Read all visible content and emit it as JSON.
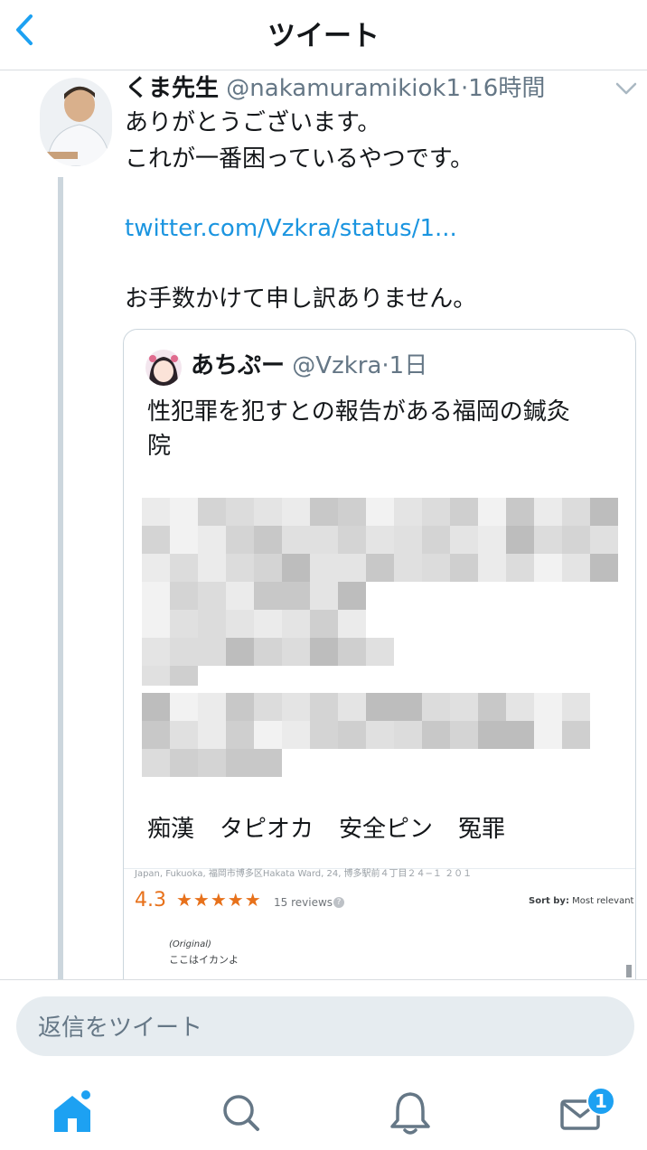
{
  "header": {
    "title": "ツイート"
  },
  "tweet": {
    "display_name": "くま先生",
    "handle": "@nakamuramikiok1",
    "separator": "·",
    "time": "16時間",
    "lines": [
      "ありがとうございます。",
      "これが一番困っているやつです。",
      "twitter.com/Vzkra/status/1...",
      "お手数かけて申し訳ありません。"
    ]
  },
  "quote": {
    "display_name": "あちぷー",
    "handle": "@Vzkra",
    "separator": "·",
    "time": "1日",
    "text_lines": [
      "性犯罪を犯すとの報告がある福岡の鍼灸",
      "院"
    ],
    "tags": [
      "痴漢",
      "タピオカ",
      "安全ピン",
      "冤罪"
    ],
    "review": {
      "address": "Japan, Fukuoka, 福岡市博多区Hakata Ward, 24, 博多駅前４丁目２４−１ ２０１",
      "rating": "4.3",
      "stars": "★★★★★",
      "count": "15 reviews",
      "sort_label": "Sort by:",
      "sort_value": "Most relevant",
      "original_label": "(Original)",
      "text": "ここはイカンよ"
    }
  },
  "composer": {
    "placeholder": "返信をツイート"
  },
  "tabbar": {
    "items": [
      "home-icon",
      "search-icon",
      "notifications-icon",
      "messages-icon"
    ],
    "messages_badge": "1"
  },
  "colors": {
    "accent": "#1da1f2",
    "link": "#1b95e0",
    "muted": "#657786",
    "rating": "#e7711b"
  }
}
